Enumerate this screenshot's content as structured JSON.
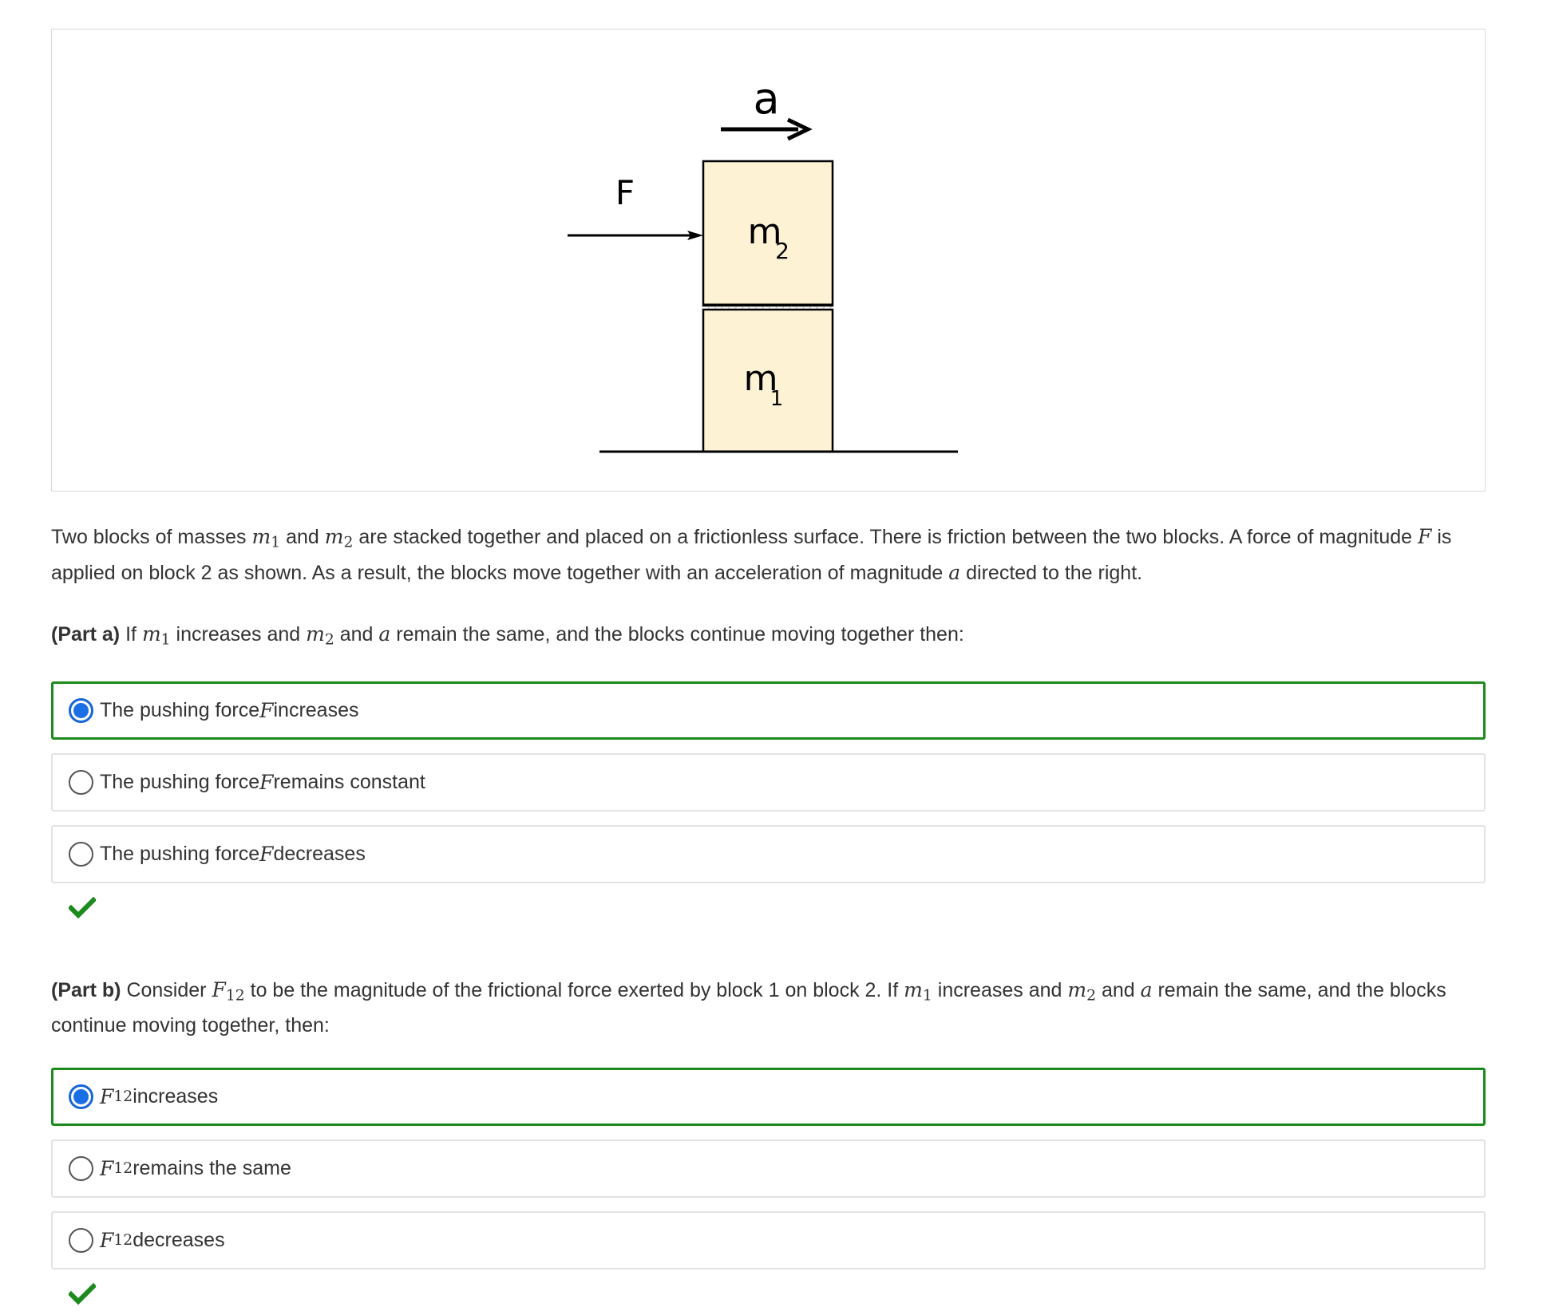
{
  "figure": {
    "accel_label": "a",
    "force_label": "F",
    "block_top_label": "m",
    "block_top_sub": "2",
    "block_bottom_label": "m",
    "block_bottom_sub": "1"
  },
  "problem": {
    "t1": "Two blocks of masses ",
    "m1": "m",
    "m1_sub": "1",
    "t2": " and ",
    "m2": "m",
    "m2_sub": "2",
    "t3": " are stacked together and placed on a frictionless surface. There is friction between the two blocks. A force of magnitude ",
    "F": "F",
    "t4": " is applied on block 2 as shown. As a result, the blocks move together with an acceleration of magnitude ",
    "a": "a",
    "t5": " directed to the right."
  },
  "part_a": {
    "label": "(Part a)",
    "t1": " If ",
    "m1": "m",
    "m1_sub": "1",
    "t2": " increases and ",
    "m2": "m",
    "m2_sub": "2",
    "t3": " and ",
    "a": "a",
    "t4": " remain the same, and the blocks continue moving together then:",
    "options": [
      {
        "pre": "The pushing force ",
        "var": "F",
        "post": " increases",
        "selected": true
      },
      {
        "pre": "The pushing force ",
        "var": "F",
        "post": " remains constant",
        "selected": false
      },
      {
        "pre": "The pushing force ",
        "var": "F",
        "post": " decreases",
        "selected": false
      }
    ],
    "result_icon": "checkmark-icon",
    "result_color": "#1c8a1c"
  },
  "part_b": {
    "label": "(Part b)",
    "t1": " Consider ",
    "F": "F",
    "F_sub": "12",
    "t2": " to be the magnitude of the frictional force exerted by block 1 on block 2. If ",
    "m1": "m",
    "m1_sub": "1",
    "t3": " increases and ",
    "m2": "m",
    "m2_sub": "2",
    "t4": " and ",
    "a": "a",
    "t5": " remain the same, and the blocks continue moving together, then:",
    "options": [
      {
        "var": "F",
        "sub": "12",
        "post": " increases",
        "selected": true
      },
      {
        "var": "F",
        "sub": "12",
        "post": " remains the same",
        "selected": false
      },
      {
        "var": "F",
        "sub": "12",
        "post": " decreases",
        "selected": false
      }
    ],
    "result_icon": "checkmark-icon",
    "result_color": "#1c8a1c"
  },
  "colors": {
    "selected_border": "#1c8a1c",
    "radio_fill": "#1a6fe6",
    "block_fill": "#fdf3d4"
  }
}
